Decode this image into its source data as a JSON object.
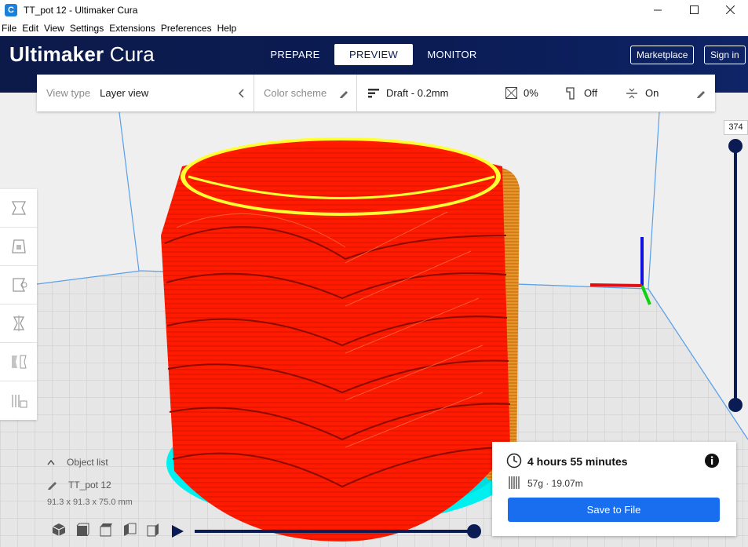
{
  "window": {
    "title": "TT_pot 12 - Ultimaker Cura",
    "app_icon": "cura-icon"
  },
  "menu": [
    "File",
    "Edit",
    "View",
    "Settings",
    "Extensions",
    "Preferences",
    "Help"
  ],
  "header": {
    "brand_bold": "Ultimaker",
    "brand_light": "Cura",
    "tabs": [
      {
        "label": "PREPARE"
      },
      {
        "label": "PREVIEW",
        "active": true
      },
      {
        "label": "MONITOR"
      }
    ],
    "marketplace_label": "Marketplace",
    "signin_label": "Sign in"
  },
  "toolbar": {
    "view_type_label": "View type",
    "view_type_value": "Layer view",
    "color_scheme_label": "Color scheme",
    "profile_value": "Draft - 0.2mm",
    "infill_value": "0%",
    "support_value": "Off",
    "adhesion_value": "On"
  },
  "layer_slider": {
    "value": "374"
  },
  "object_list": {
    "header": "Object list",
    "item": "TT_pot 12",
    "dimensions": "91.3 x 91.3 x 75.0 mm"
  },
  "print_info": {
    "time": "4 hours 55 minutes",
    "material": "57g · 19.07m",
    "save_label": "Save to File"
  },
  "colors": {
    "brand": "#0b1c55",
    "accent": "#196ef0",
    "model_wall": "#ff1a00",
    "model_top": "#ffff00",
    "skirt": "#00ffff"
  }
}
